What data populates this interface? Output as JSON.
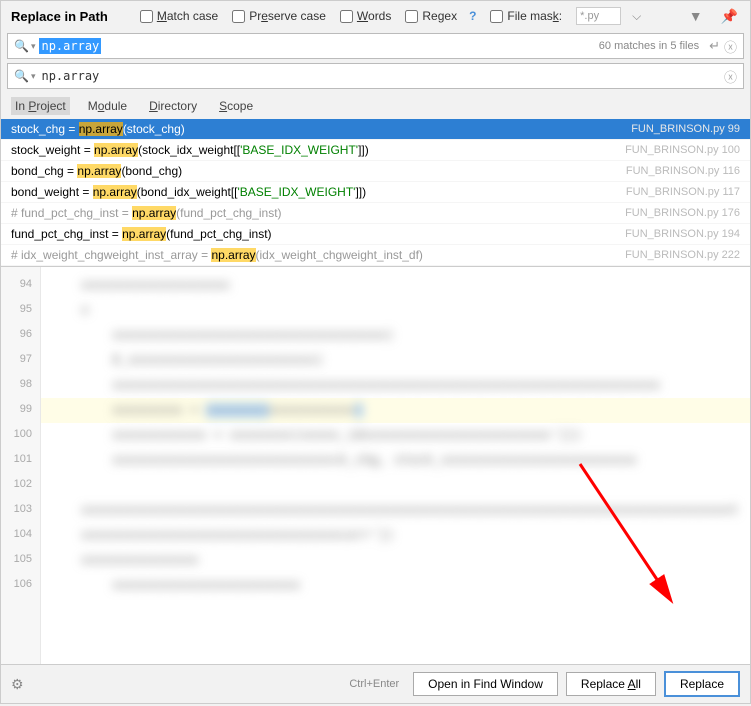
{
  "title": "Replace in Path",
  "options": {
    "match_case": "Match case",
    "preserve_case": "Preserve case",
    "words": "Words",
    "regex": "Regex",
    "regex_help": "?",
    "file_mask": "File mask:",
    "mask_value": "*.py"
  },
  "search": {
    "value": "np.array",
    "match_info": "60 matches in 5 files"
  },
  "replace": {
    "value": "np.array"
  },
  "scopes": {
    "in_project": "In Project",
    "module": "Module",
    "directory": "Directory",
    "scope": "Scope"
  },
  "results": [
    {
      "pre": "stock_chg = ",
      "hl": "np.array",
      "post": "(stock_chg)",
      "file": "FUN_BRINSON.py",
      "line": "99",
      "sel": true
    },
    {
      "pre": "stock_weight = ",
      "hl": "np.array",
      "post_a": "(stock_idx_weight[[",
      "str": "'BASE_IDX_WEIGHT'",
      "post_b": "]])",
      "file": "FUN_BRINSON.py",
      "line": "100"
    },
    {
      "pre": "bond_chg = ",
      "hl": "np.array",
      "post": "(bond_chg)",
      "file": "FUN_BRINSON.py",
      "line": "116"
    },
    {
      "pre": "bond_weight = ",
      "hl": "np.array",
      "post_a": "(bond_idx_weight[[",
      "str": "'BASE_IDX_WEIGHT'",
      "post_b": "]])",
      "file": "FUN_BRINSON.py",
      "line": "117"
    },
    {
      "cmt_pre": "# fund_pct_chg_inst = ",
      "hl": "np.array",
      "cmt_post": "(fund_pct_chg_inst)",
      "comment": true,
      "file": "FUN_BRINSON.py",
      "line": "176"
    },
    {
      "pre": "fund_pct_chg_inst = ",
      "hl": "np.array",
      "post": "(fund_pct_chg_inst)",
      "file": "FUN_BRINSON.py",
      "line": "194"
    },
    {
      "cmt_pre": "# idx_weight_chgweight_inst_array = ",
      "hl": "np.array",
      "cmt_post": "(idx_weight_chgweight_inst_df)",
      "comment": true,
      "file": "FUN_BRINSON.py",
      "line": "222"
    }
  ],
  "preview_lines": [
    "94",
    "95",
    "96",
    "97",
    "98",
    "99",
    "100",
    "101",
    "102",
    "103",
    "104",
    "105",
    "106"
  ],
  "bottom": {
    "hint": "Ctrl+Enter",
    "open": "Open in Find Window",
    "replace_all": "Replace All",
    "replace": "Replace"
  }
}
